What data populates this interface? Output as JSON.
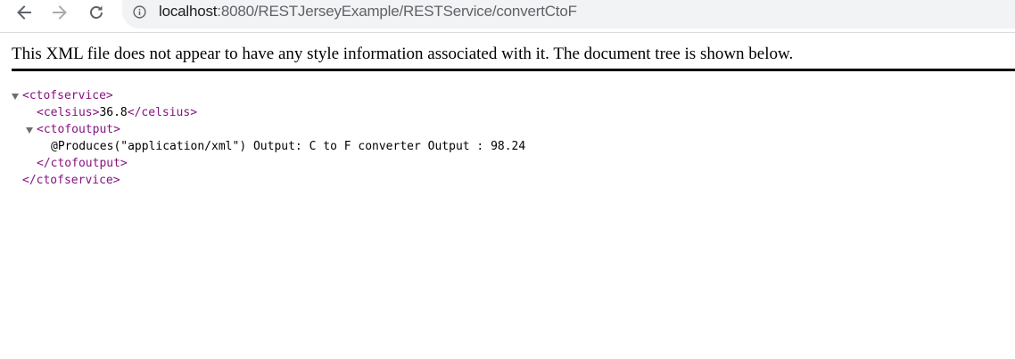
{
  "browser": {
    "url_host": "localhost",
    "url_path": ":8080/RESTJerseyExample/RESTService/convertCtoF",
    "icons": {
      "back": "back-arrow-icon",
      "forward": "forward-arrow-icon",
      "reload": "reload-icon",
      "site_info": "info-icon"
    }
  },
  "xml_viewer": {
    "notice": "This XML file does not appear to have any style information associated with it. The document tree is shown below.",
    "tree": {
      "ctofservice_open": "<ctofservice>",
      "celsius_open": "<celsius>",
      "celsius_value": "36.8",
      "celsius_close": "</celsius>",
      "ctofoutput_open": "<ctofoutput>",
      "ctofoutput_text": "@Produces(\"application/xml\") Output: C to F converter Output : 98.24",
      "ctofoutput_close": "</ctofoutput>",
      "ctofservice_close": "</ctofservice>"
    }
  },
  "colors": {
    "tag": "#881280",
    "text": "#000000",
    "omnibox_bg": "#f1f3f4",
    "icon": "#5f6368"
  }
}
